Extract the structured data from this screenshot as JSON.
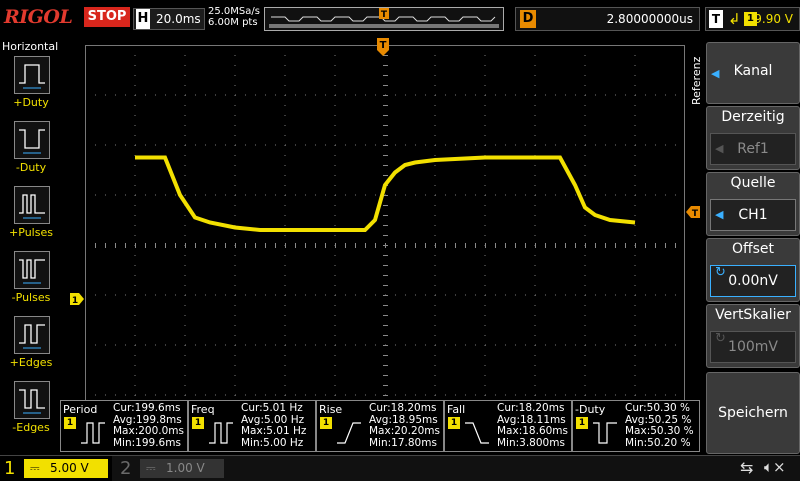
{
  "header": {
    "logo": "RIGOL",
    "run_state": "STOP",
    "timebase_label": "H",
    "timebase_value": "20.0ms",
    "sample_rate": "25.0MSa/s",
    "memory_depth": "6.00M pts",
    "delay_label": "D",
    "delay_value": "2.80000000us",
    "trigger_label": "T",
    "trigger_channel": "1",
    "trigger_level": "9.90 V"
  },
  "left_menu": {
    "title": "Horizontal",
    "items": [
      {
        "label": "+Duty",
        "icon": "positive-duty-icon"
      },
      {
        "label": "-Duty",
        "icon": "negative-duty-icon"
      },
      {
        "label": "+Pulses",
        "icon": "positive-pulses-icon"
      },
      {
        "label": "-Pulses",
        "icon": "negative-pulses-icon"
      },
      {
        "label": "+Edges",
        "icon": "rising-edges-icon"
      },
      {
        "label": "-Edges",
        "icon": "falling-edges-icon"
      }
    ]
  },
  "screen": {
    "trigger_marker": "T",
    "channel_marker": "1",
    "waveform_color": "#f2e000",
    "waveform": {
      "x_ms": [
        -100,
        -88,
        -82,
        -76,
        -70,
        -60,
        -50,
        -40,
        -30,
        -20,
        -12,
        -8,
        -4,
        0,
        4,
        8,
        12,
        20,
        40,
        60,
        70,
        76,
        80,
        84,
        90,
        100
      ],
      "y_div": [
        1.75,
        1.75,
        1.0,
        0.55,
        0.45,
        0.35,
        0.3,
        0.3,
        0.3,
        0.3,
        0.3,
        0.3,
        0.5,
        1.2,
        1.45,
        1.6,
        1.65,
        1.7,
        1.75,
        1.75,
        1.75,
        1.2,
        0.75,
        0.6,
        0.5,
        0.45
      ]
    }
  },
  "right_menu": {
    "side_label": "Referenz",
    "kanal_label": "Kanal",
    "derzeitig_label": "Derzeitig",
    "derzeitig_value": "Ref1",
    "quelle_label": "Quelle",
    "quelle_value": "CH1",
    "offset_label": "Offset",
    "offset_value": "0.00nV",
    "vertskalier_label": "VertSkalier",
    "vertskalier_value": "100mV",
    "speichern_label": "Speichern"
  },
  "measurements": [
    {
      "name": "Period",
      "channel": "1",
      "cur": "Cur:199.6ms",
      "avg": "Avg:199.8ms",
      "max": "Max:200.0ms",
      "min": "Min:199.6ms"
    },
    {
      "name": "Freq",
      "channel": "1",
      "cur": "Cur:5.01 Hz",
      "avg": "Avg:5.00 Hz",
      "max": "Max:5.01 Hz",
      "min": "Min:5.00 Hz"
    },
    {
      "name": "Rise",
      "channel": "1",
      "cur": "Cur:18.20ms",
      "avg": "Avg:18.95ms",
      "max": "Max:20.20ms",
      "min": "Min:17.80ms"
    },
    {
      "name": "Fall",
      "channel": "1",
      "cur": "Cur:18.20ms",
      "avg": "Avg:18.11ms",
      "max": "Max:18.60ms",
      "min": "Min:3.800ms"
    },
    {
      "name": "-Duty",
      "channel": "1",
      "cur": "Cur:50.30 %",
      "avg": "Avg:50.25 %",
      "max": "Max:50.30 %",
      "min": "Min:50.20 %"
    }
  ],
  "bottom_bar": {
    "ch1_number": "1",
    "ch1_scale": "5.00 V",
    "ch2_number": "2",
    "ch2_scale": "1.00 V",
    "usb_icon": "usb-icon",
    "speaker_icon": "speaker-muted-icon"
  }
}
